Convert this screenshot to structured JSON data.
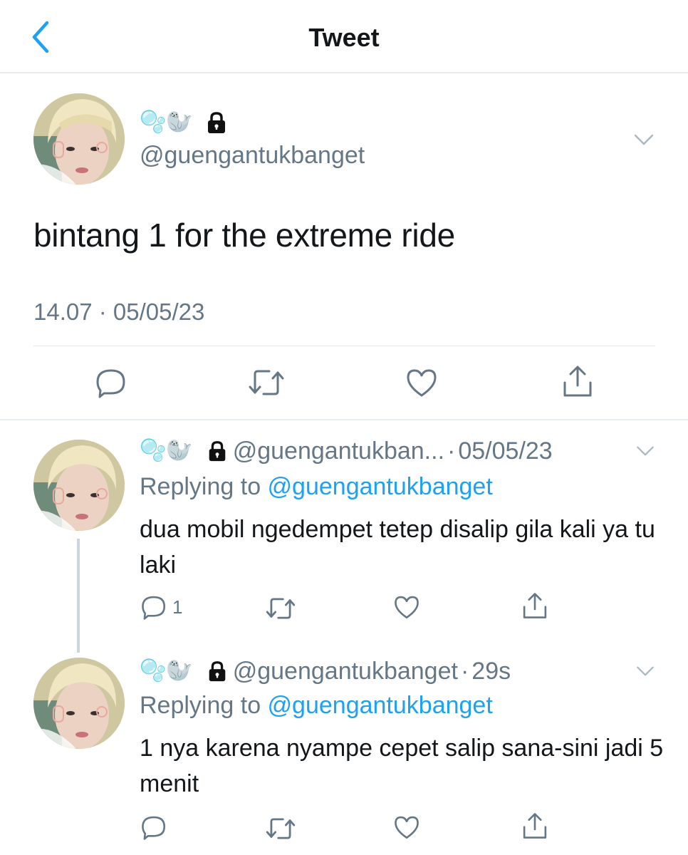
{
  "header": {
    "title": "Tweet"
  },
  "main_tweet": {
    "emojis": "🫧🦭",
    "handle": "@guengantukbanget",
    "text": "bintang 1 for the extreme ride",
    "timestamp": "14.07 · 05/05/23"
  },
  "replies": [
    {
      "emojis": "🫧🦭",
      "handle": "@guengantukban...",
      "separator": "·",
      "time": "05/05/23",
      "replying_label": "Replying to ",
      "replying_to": "@guengantukbanget",
      "text": "dua mobil ngedempet tetep disalip gila kali ya tu laki",
      "reply_count": "1"
    },
    {
      "emojis": "🫧🦭",
      "handle": "@guengantukbanget",
      "separator": "·",
      "time": "29s",
      "replying_label": "Replying to ",
      "replying_to": "@guengantukbanget",
      "text": "1 nya karena nyampe cepet salip sana-sini jadi 5 menit",
      "reply_count": ""
    }
  ],
  "colors": {
    "accent": "#1da1f2",
    "secondary_text": "#657786",
    "primary_text": "#14171a",
    "divider": "#e6ecf0"
  },
  "icons": {
    "back": "chevron-left-icon",
    "lock": "lock-icon",
    "caret": "chevron-down-icon",
    "reply": "reply-icon",
    "retweet": "retweet-icon",
    "like": "heart-icon",
    "share": "share-icon"
  }
}
